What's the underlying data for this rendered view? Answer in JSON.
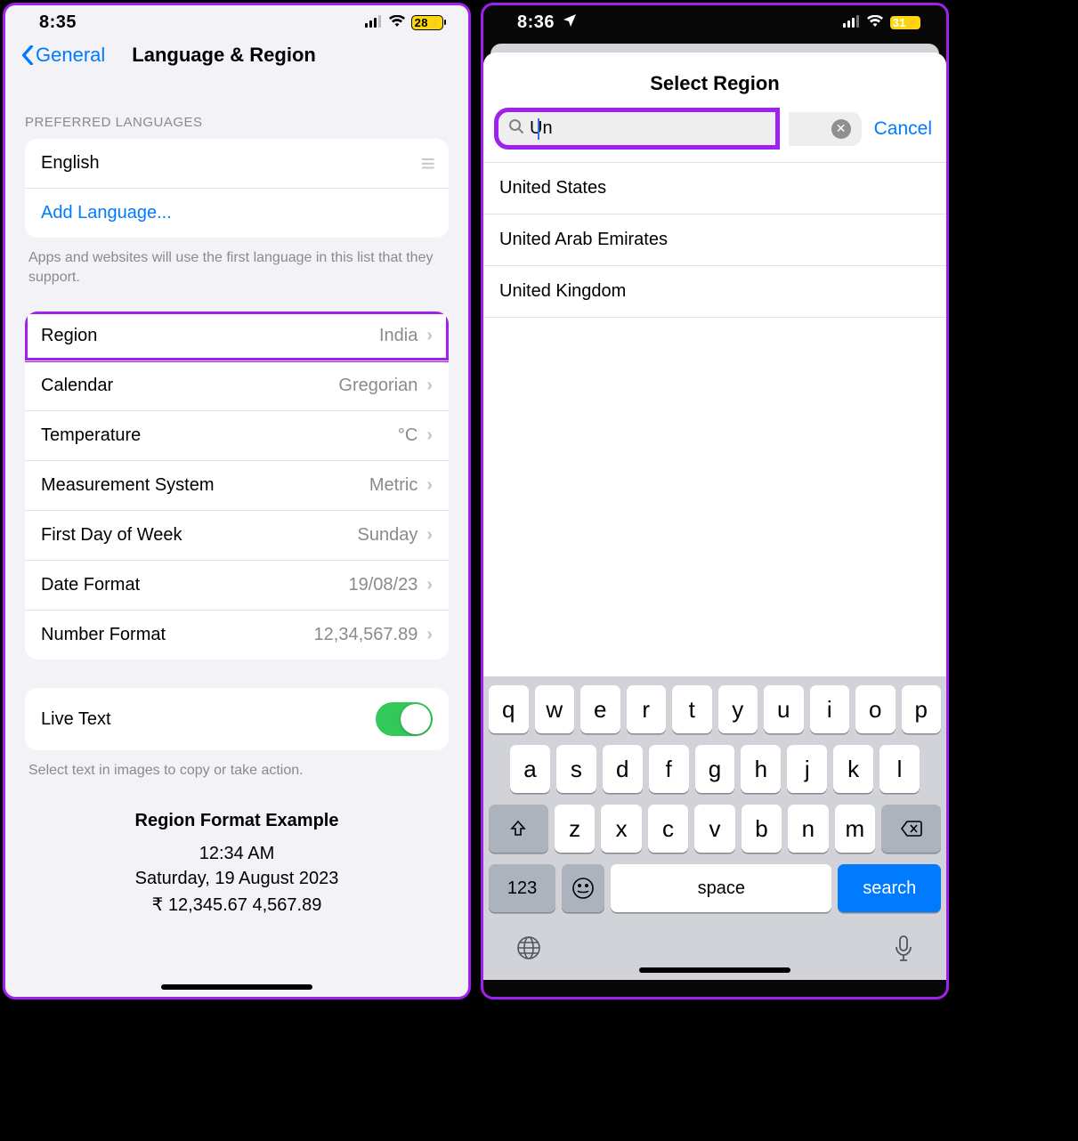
{
  "left": {
    "status": {
      "time": "8:35",
      "battery": "28"
    },
    "nav": {
      "back": "General",
      "title": "Language & Region"
    },
    "lang_header": "PREFERRED LANGUAGES",
    "languages": [
      "English"
    ],
    "add_language": "Add Language...",
    "lang_footer": "Apps and websites will use the first language in this list that they support.",
    "rows": {
      "region": {
        "label": "Region",
        "value": "India"
      },
      "calendar": {
        "label": "Calendar",
        "value": "Gregorian"
      },
      "temperature": {
        "label": "Temperature",
        "value": "°C"
      },
      "measurement": {
        "label": "Measurement System",
        "value": "Metric"
      },
      "firstday": {
        "label": "First Day of Week",
        "value": "Sunday"
      },
      "dateformat": {
        "label": "Date Format",
        "value": "19/08/23"
      },
      "numberformat": {
        "label": "Number Format",
        "value": "12,34,567.89"
      }
    },
    "livetext": {
      "label": "Live Text",
      "on": true
    },
    "livetext_footer": "Select text in images to copy or take action.",
    "example": {
      "title": "Region Format Example",
      "time": "12:34 AM",
      "date": "Saturday, 19 August 2023",
      "numbers": "₹ 12,345.67    4,567.89"
    }
  },
  "right": {
    "status": {
      "time": "8:36",
      "battery": "31"
    },
    "sheet_title": "Select Region",
    "search": {
      "value": "Un",
      "placeholder": "Search"
    },
    "cancel": "Cancel",
    "results": [
      "United States",
      "United Arab Emirates",
      "United Kingdom"
    ],
    "keyboard": {
      "row1": [
        "q",
        "w",
        "e",
        "r",
        "t",
        "y",
        "u",
        "i",
        "o",
        "p"
      ],
      "row2": [
        "a",
        "s",
        "d",
        "f",
        "g",
        "h",
        "j",
        "k",
        "l"
      ],
      "row3": [
        "z",
        "x",
        "c",
        "v",
        "b",
        "n",
        "m"
      ],
      "numkey": "123",
      "space": "space",
      "search": "search"
    }
  }
}
